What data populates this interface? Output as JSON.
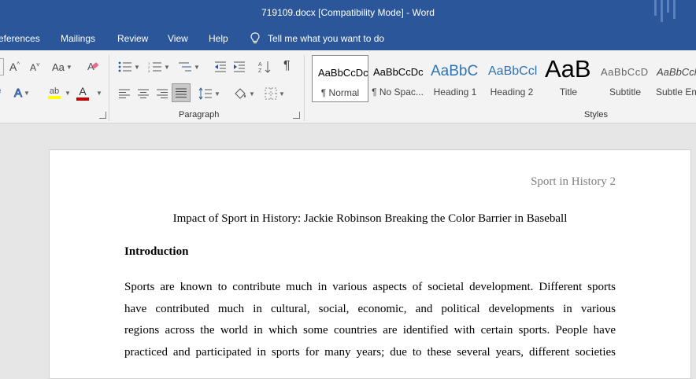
{
  "window": {
    "title": "719109.docx [Compatibility Mode]  -  Word"
  },
  "menu": {
    "tabs": [
      "eferences",
      "Mailings",
      "Review",
      "View",
      "Help"
    ],
    "tell_me": "Tell me what you want to do"
  },
  "ribbon": {
    "groups": {
      "paragraph": "Paragraph",
      "styles": "Styles"
    },
    "styles": [
      {
        "preview": "AaBbCcDc",
        "name": "¶ Normal"
      },
      {
        "preview": "AaBbCcDc",
        "name": "¶ No Spac..."
      },
      {
        "preview": "AaBbC",
        "name": "Heading 1"
      },
      {
        "preview": "AaBbCcl",
        "name": "Heading 2"
      },
      {
        "preview": "AaB",
        "name": "Title"
      },
      {
        "preview": "AaBbCcD",
        "name": "Subtitle"
      },
      {
        "preview": "AaBbCcl",
        "name": "Subtle Em"
      }
    ],
    "colors": {
      "highlight": "#ffff00",
      "font_color": "#c00000",
      "accent": "#2b579a"
    }
  },
  "document": {
    "header": "Sport in History 2",
    "title": "Impact of Sport in History: Jackie Robinson Breaking the Color Barrier in Baseball",
    "heading": "Introduction",
    "lines": [
      "Sports are known to contribute much in various aspects of societal development. Different sports",
      "have contributed much in cultural, social, economic, and political developments in various",
      "regions across the world in which some countries are identified with certain sports. People have",
      "practiced and participated in sports for many years; due to these several years, different societies"
    ]
  }
}
